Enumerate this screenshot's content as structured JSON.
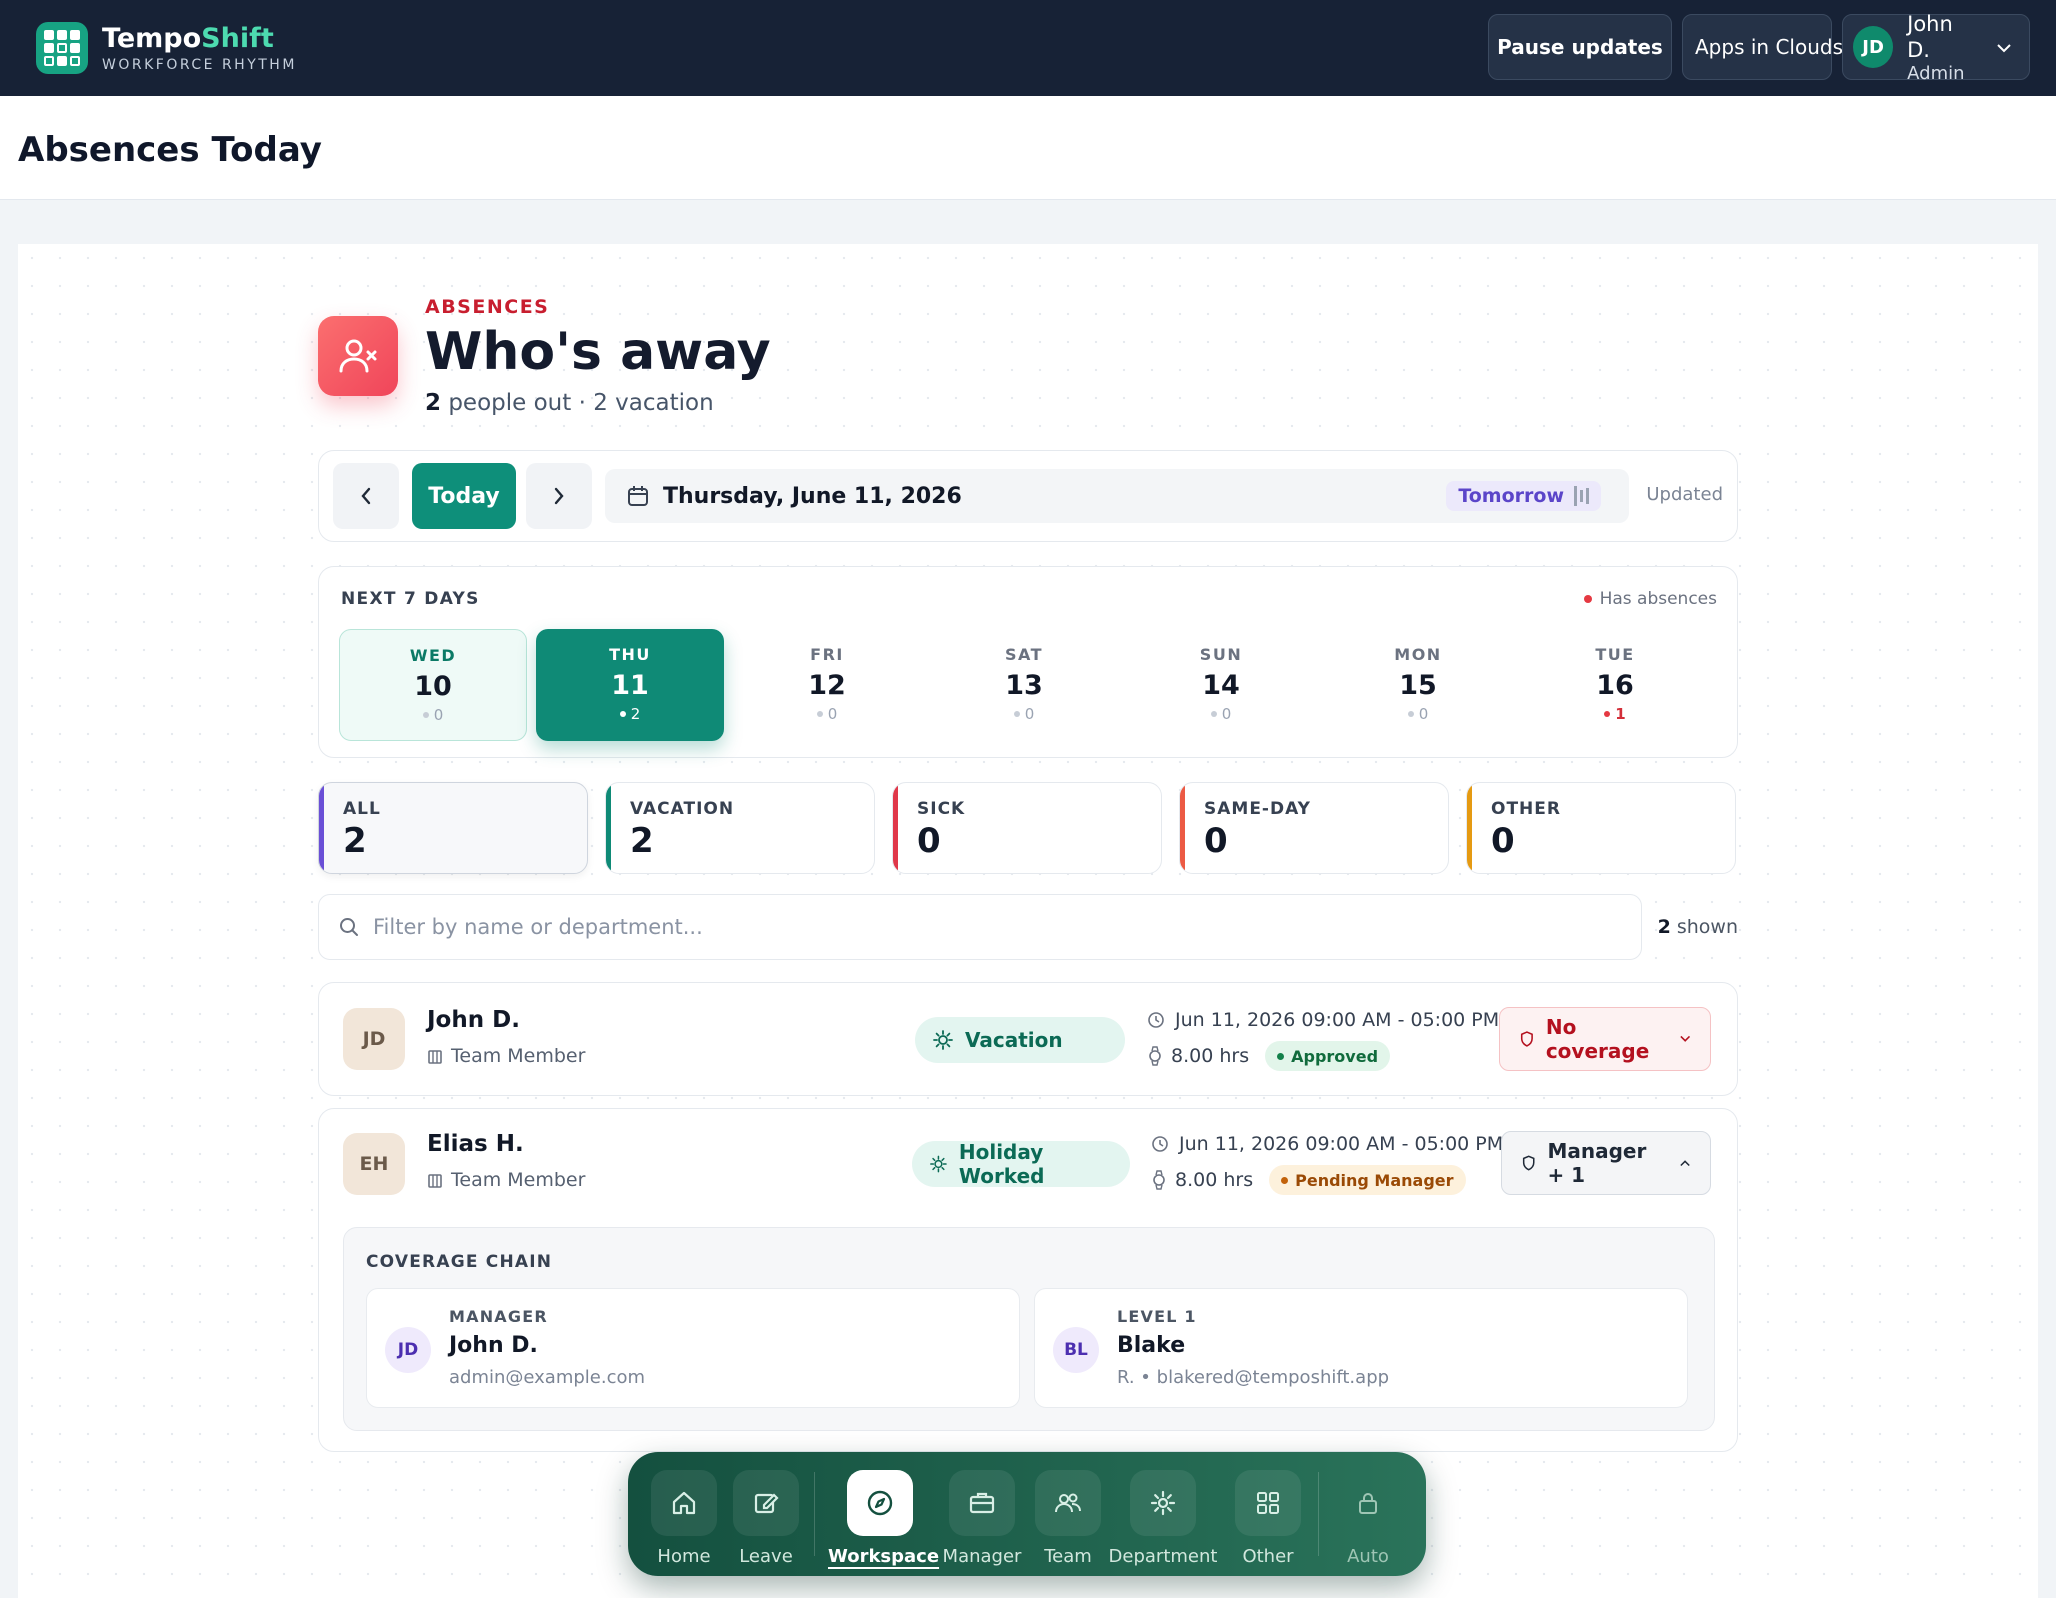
{
  "app": {
    "name_main": "Tempo",
    "name_accent": "Shift",
    "tagline": "WORKFORCE RHYTHM"
  },
  "topbar": {
    "pause_label": "Pause updates",
    "org_label": "Apps in Clouds",
    "user_initials": "JD",
    "user_name": "John D.",
    "user_role": "Admin"
  },
  "page": {
    "title": "Absences Today"
  },
  "hero": {
    "eyebrow": "ABSENCES",
    "title": "Who's away",
    "count": "2",
    "summary": "people out · 2 vacation"
  },
  "datenav": {
    "prev": "‹",
    "today_label": "Today",
    "next": "›",
    "date": "Thursday, June 11, 2026",
    "tomorrow_label": "Tomorrow",
    "updated_label": "Updated"
  },
  "week": {
    "label": "NEXT 7 DAYS",
    "legend": "Has absences",
    "days": [
      {
        "name": "WED",
        "num": "10",
        "count": "0"
      },
      {
        "name": "THU",
        "num": "11",
        "count": "2"
      },
      {
        "name": "FRI",
        "num": "12",
        "count": "0"
      },
      {
        "name": "SAT",
        "num": "13",
        "count": "0"
      },
      {
        "name": "SUN",
        "num": "14",
        "count": "0"
      },
      {
        "name": "MON",
        "num": "15",
        "count": "0"
      },
      {
        "name": "TUE",
        "num": "16",
        "count": "1"
      }
    ]
  },
  "stats": [
    {
      "label": "ALL",
      "value": "2",
      "color": "#6a4fd6"
    },
    {
      "label": "VACATION",
      "value": "2",
      "color": "#0f8a76"
    },
    {
      "label": "SICK",
      "value": "0",
      "color": "#e0384a"
    },
    {
      "label": "SAME-DAY",
      "value": "0",
      "color": "#ec5a44"
    },
    {
      "label": "OTHER",
      "value": "0",
      "color": "#e59a12"
    }
  ],
  "filter": {
    "placeholder": "Filter by name or department...",
    "shown_count": "2",
    "shown_label": "shown"
  },
  "absences": [
    {
      "initials": "JD",
      "name": "John D.",
      "role": "Team Member",
      "type": "Vacation",
      "time": "Jun 11, 2026 09:00 AM - 05:00 PM",
      "hours": "8.00 hrs",
      "status": "Approved",
      "coverage": "No coverage"
    },
    {
      "initials": "EH",
      "name": "Elias H.",
      "role": "Team Member",
      "type": "Holiday Worked",
      "time": "Jun 11, 2026 09:00 AM - 05:00 PM",
      "hours": "8.00 hrs",
      "status": "Pending Manager",
      "coverage": "Manager + 1"
    }
  ],
  "coverage_chain": {
    "title": "COVERAGE CHAIN",
    "people": [
      {
        "level": "MANAGER",
        "initials": "JD",
        "name": "John D.",
        "detail": "admin@example.com"
      },
      {
        "level": "LEVEL 1",
        "initials": "BL",
        "name": "Blake",
        "detail": "R. • blakered@temposhift.app"
      }
    ]
  },
  "dock": {
    "items": [
      {
        "label": "Home",
        "icon": "home-icon"
      },
      {
        "label": "Leave",
        "icon": "edit-icon"
      },
      {
        "label": "Workspace",
        "icon": "compass-icon"
      },
      {
        "label": "Manager",
        "icon": "briefcase-icon"
      },
      {
        "label": "Team",
        "icon": "users-icon"
      },
      {
        "label": "Department",
        "icon": "gear-icon"
      },
      {
        "label": "Other",
        "icon": "grid-icon"
      },
      {
        "label": "Auto",
        "icon": "lock-icon"
      }
    ]
  }
}
